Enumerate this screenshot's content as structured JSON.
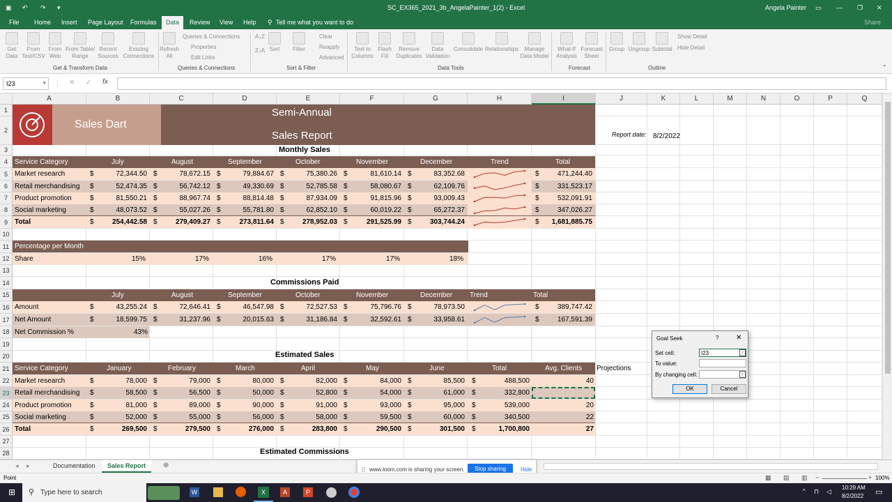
{
  "window": {
    "title": "SC_EX365_2021_3b_AngelaPainter_1(2) - Excel",
    "user": "Angela Painter",
    "share": "Share"
  },
  "menu": [
    "File",
    "Home",
    "Insert",
    "Page Layout",
    "Formulas",
    "Data",
    "Review",
    "View",
    "Help"
  ],
  "tellme": "Tell me what you want to do",
  "ribbon": {
    "get_transform": {
      "label": "Get & Transform Data",
      "items": [
        "Get Data",
        "From Text/CSV",
        "From Web",
        "From Table/ Range",
        "Recent Sources",
        "Existing Connections"
      ]
    },
    "queries": {
      "label": "Queries & Connections",
      "refresh": "Refresh All",
      "items": [
        "Queries & Connections",
        "Properties",
        "Edit Links"
      ]
    },
    "sort_filter": {
      "label": "Sort & Filter",
      "sort": "Sort",
      "filter": "Filter",
      "items": [
        "Clear",
        "Reapply",
        "Advanced"
      ]
    },
    "data_tools": {
      "label": "Data Tools",
      "items": [
        "Text to Columns",
        "Flash Fill",
        "Remove Duplicates",
        "Data Validation",
        "Consolidate",
        "Relationships",
        "Manage Data Model"
      ]
    },
    "forecast": {
      "label": "Forecast",
      "items": [
        "What-If Analysis",
        "Forecast Sheet"
      ]
    },
    "outline": {
      "label": "Outline",
      "items": [
        "Group",
        "Ungroup",
        "Subtotal"
      ],
      "show": "Show Detail",
      "hide": "Hide Detail"
    }
  },
  "namebox": "I23",
  "columns": [
    "A",
    "B",
    "C",
    "D",
    "E",
    "F",
    "G",
    "H",
    "I",
    "J",
    "K",
    "L",
    "M",
    "N",
    "O",
    "P",
    "Q"
  ],
  "rows": [
    "1",
    "2",
    "3",
    "4",
    "5",
    "6",
    "7",
    "8",
    "9",
    "10",
    "11",
    "12",
    "13",
    "14",
    "15",
    "16",
    "17",
    "18",
    "19",
    "20",
    "21",
    "22",
    "23",
    "24",
    "25",
    "26",
    "27",
    "28"
  ],
  "header": {
    "brand": "Sales Dart",
    "title1": "Semi-Annual",
    "title2": "Sales Report",
    "report_date_label": "Report date:",
    "report_date": "8/2/2022"
  },
  "monthly": {
    "title": "Monthly Sales",
    "headers": [
      "Service Category",
      "July",
      "August",
      "September",
      "October",
      "November",
      "December",
      "Trend",
      "Total"
    ],
    "rows": [
      {
        "name": "Market research",
        "vals": [
          "72,344.50",
          "78,672.15",
          "79,884.67",
          "75,380.26",
          "81,610.14",
          "83,352.68"
        ],
        "total": "471,244.40"
      },
      {
        "name": "Retail merchandising",
        "vals": [
          "52,474.35",
          "56,742.12",
          "49,330.69",
          "52,785.58",
          "58,080.67",
          "62,109.76"
        ],
        "total": "331,523.17"
      },
      {
        "name": "Product promotion",
        "vals": [
          "81,550.21",
          "88,967.74",
          "88,814.48",
          "87,934.09",
          "91,815.96",
          "93,009.43"
        ],
        "total": "532,091.91"
      },
      {
        "name": "Social marketing",
        "vals": [
          "48,073.52",
          "55,027.26",
          "55,781.80",
          "62,852.10",
          "60,019.22",
          "65,272.37"
        ],
        "total": "347,026.27"
      }
    ],
    "total": {
      "name": "Total",
      "vals": [
        "254,442.58",
        "279,409.27",
        "273,811.64",
        "278,952.03",
        "291,525.99",
        "303,744.24"
      ],
      "total": "1,681,885.75"
    }
  },
  "percent": {
    "title": "Percentage per Month",
    "label": "Share",
    "vals": [
      "15%",
      "17%",
      "16%",
      "17%",
      "17%",
      "18%"
    ]
  },
  "commissions": {
    "title": "Commissions Paid",
    "headers": [
      "July",
      "August",
      "September",
      "October",
      "November",
      "December",
      "Trend",
      "Total"
    ],
    "rows": [
      {
        "name": "Amount",
        "vals": [
          "43,255.24",
          "72,646.41",
          "46,547.98",
          "72,527.53",
          "75,796.76",
          "78,973.50"
        ],
        "total": "389,747.42"
      },
      {
        "name": "Net Amount",
        "vals": [
          "18,599.75",
          "31,237.96",
          "20,015.63",
          "31,186.84",
          "32,592.61",
          "33,958.61"
        ],
        "total": "167,591.39"
      }
    ],
    "net_pct_label": "Net Commission %",
    "net_pct": "43%"
  },
  "estimated": {
    "title": "Estimated Sales",
    "headers": [
      "Service Category",
      "January",
      "February",
      "March",
      "April",
      "May",
      "June",
      "Total",
      "Avg. Clients",
      "Projections"
    ],
    "rows": [
      {
        "name": "Market research",
        "vals": [
          "78,000",
          "79,000",
          "80,000",
          "82,000",
          "84,000",
          "85,500"
        ],
        "total": "488,500",
        "clients": "40"
      },
      {
        "name": "Retail merchandising",
        "vals": [
          "58,500",
          "56,500",
          "50,000",
          "52,800",
          "54,000",
          "61,000"
        ],
        "total": "332,800",
        "clients": ""
      },
      {
        "name": "Product promotion",
        "vals": [
          "81,000",
          "89,000",
          "90,000",
          "91,000",
          "93,000",
          "95,000"
        ],
        "total": "539,000",
        "clients": "20"
      },
      {
        "name": "Social marketing",
        "vals": [
          "52,000",
          "55,000",
          "56,000",
          "58,000",
          "59,500",
          "60,000"
        ],
        "total": "340,500",
        "clients": "22"
      }
    ],
    "total": {
      "name": "Total",
      "vals": [
        "269,500",
        "279,500",
        "276,000",
        "283,800",
        "290,500",
        "301,500"
      ],
      "total": "1,700,800",
      "clients": "27"
    }
  },
  "est_comm_title": "Estimated Commissions",
  "dollar": "$",
  "goalseek": {
    "title": "Goal Seek",
    "help": "?",
    "set_cell_label": "Set cell:",
    "set_cell": "I23",
    "to_value_label": "To value:",
    "changing_label": "By changing cell:",
    "ok": "OK",
    "cancel": "Cancel"
  },
  "sheets": [
    "Documentation",
    "Sales Report"
  ],
  "loom": {
    "text": "www.loom.com is sharing your screen.",
    "stop": "Stop sharing",
    "hide": "Hide"
  },
  "status": {
    "mode": "Point",
    "zoom": "100%"
  },
  "taskbar": {
    "search": "Type here to search",
    "time": "10:29 AM",
    "date": "8/2/2022"
  },
  "colors": {
    "excel_green": "#217346",
    "brown": "#7b5d52",
    "peach": "#fbe0d0",
    "tan": "#dcc8bd",
    "logo_red": "#b83a36"
  }
}
